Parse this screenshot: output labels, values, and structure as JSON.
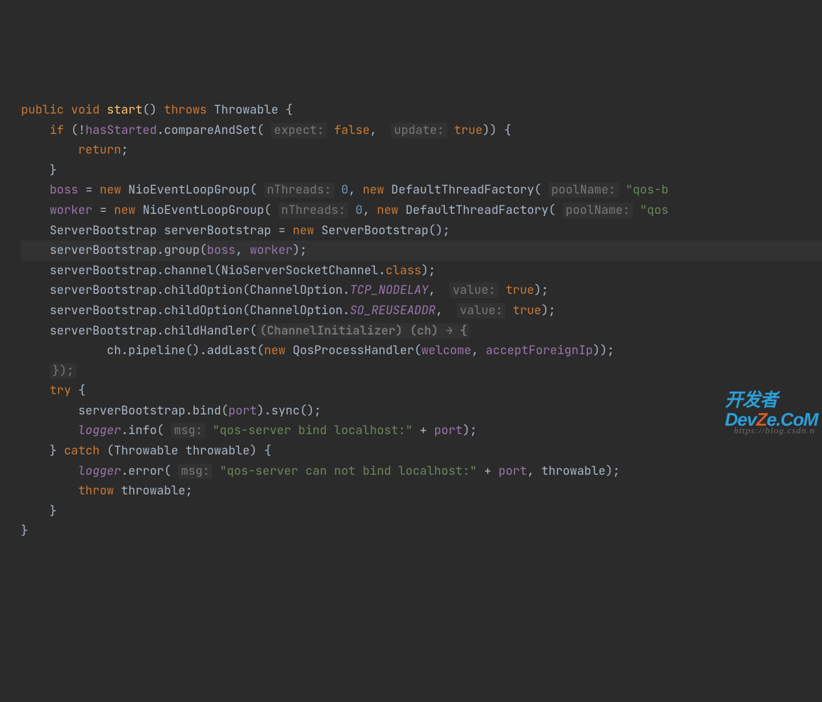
{
  "code": {
    "l1": {
      "kw1": "public void",
      "fn": "start",
      "kw2": "throws",
      "cls": "Throwable {"
    },
    "l2": {
      "kw": "if",
      "paren": "(!",
      "fld": "hasStarted",
      "call": ".compareAndSet(",
      "hint1": "expect:",
      "kw1": "false",
      "comma": ", ",
      "hint2": "update:",
      "kw2": "true",
      "end": ")) {"
    },
    "l3": {
      "kw": "return",
      "semi": ";"
    },
    "l4": {
      "brace": "}"
    },
    "l5": {
      "fld": "boss",
      "eq": " = ",
      "kw1": "new",
      "cls1": "NioEventLoopGroup(",
      "hint": "nThreads:",
      "num": "0",
      "comma": ", ",
      "kw2": "new",
      "cls2": "DefaultThreadFactory(",
      "hint2": "poolName:",
      "str": "\"qos-b"
    },
    "l6": {
      "fld": "worker",
      "eq": " = ",
      "kw1": "new",
      "cls1": "NioEventLoopGroup(",
      "hint": "nThreads:",
      "num": "0",
      "comma": ", ",
      "kw2": "new",
      "cls2": "DefaultThreadFactory(",
      "hint2": "poolName:",
      "str": "\"qos"
    },
    "l7": {
      "cls": "ServerBootstrap serverBootstrap = ",
      "kw": "new",
      "cls2": "ServerBootstrap();"
    },
    "l8": {
      "txt": "serverBootstrap.group(",
      "fld1": "boss",
      "comma": ", ",
      "fld2": "worker",
      "end": ");"
    },
    "l9": {
      "txt": "serverBootstrap.channel(NioServerSocketChannel.",
      "kw": "class",
      "end": ");"
    },
    "l10": {
      "txt": "serverBootstrap.childOption(ChannelOption.",
      "const": "TCP_NODELAY",
      "comma": ", ",
      "hint": "value:",
      "kw": "true",
      "end": ");"
    },
    "l11": {
      "txt": "serverBootstrap.childOption(ChannelOption.",
      "const": "SO_REUSEADDR",
      "comma": ", ",
      "hint": "value:",
      "kw": "true",
      "end": ");"
    },
    "l12": {
      "txt": "serverBootstrap.childHandler(",
      "lambda": "(ChannelInitializer) (ch) → {"
    },
    "l13": {
      "txt": "ch.pipeline().addLast(",
      "kw": "new",
      "cls": "QosProcessHandler(",
      "fld1": "welcome",
      "comma": ", ",
      "fld2": "acceptForeignIp",
      "end": "));"
    },
    "l14": {
      "end": "});"
    },
    "l15": {
      "kw": "try",
      "brace": " {"
    },
    "l16": {
      "txt": "serverBootstrap.bind(",
      "fld": "port",
      "end": ").sync();"
    },
    "l17": {
      "fld": "logger",
      "call": ".info(",
      "hint": "msg:",
      "str": "\"qos-server bind localhost:\"",
      "plus": " + ",
      "fld2": "port",
      "end": ");"
    },
    "l18": {
      "brace": "} ",
      "kw": "catch",
      "paren": " (Throwable throwable) {"
    },
    "l19": {
      "fld": "logger",
      "call": ".error(",
      "hint": "msg:",
      "str": "\"qos-server can not bind localhost:\"",
      "plus": " + ",
      "fld2": "port",
      "comma": ", throwable);"
    },
    "l20": {
      "kw": "throw",
      "txt": " throwable;"
    },
    "l21": {
      "brace": "}"
    },
    "l22": {
      "brace": "}"
    }
  },
  "watermark": "https://blog.csdn.n",
  "logo": {
    "cn": "开发者",
    "p1": "Dev",
    "p2": "Z",
    "p3": "e.CoM"
  }
}
